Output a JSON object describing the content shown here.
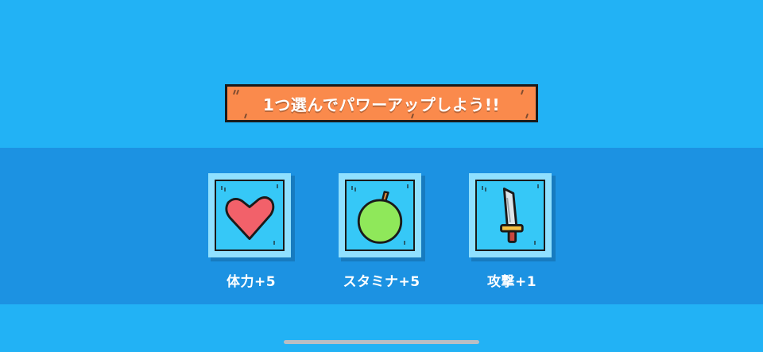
{
  "prompt": {
    "text": "1つ選んでパワーアップしよう!!"
  },
  "options": [
    {
      "label": "体力+5",
      "icon": "heart-icon"
    },
    {
      "label": "スタミナ+5",
      "icon": "apple-icon"
    },
    {
      "label": "攻撃+1",
      "icon": "sword-icon"
    }
  ],
  "colors": {
    "background": "#22b2f5",
    "band": "#1c92e2",
    "banner": "#fa8a4c",
    "card_inner": "#36c8f7",
    "card_frame": "#8fe0ff",
    "heart": "#f2616a",
    "apple": "#8fe85a",
    "sword_blade": "#dde5ea",
    "sword_hilt": "#f5c043"
  }
}
